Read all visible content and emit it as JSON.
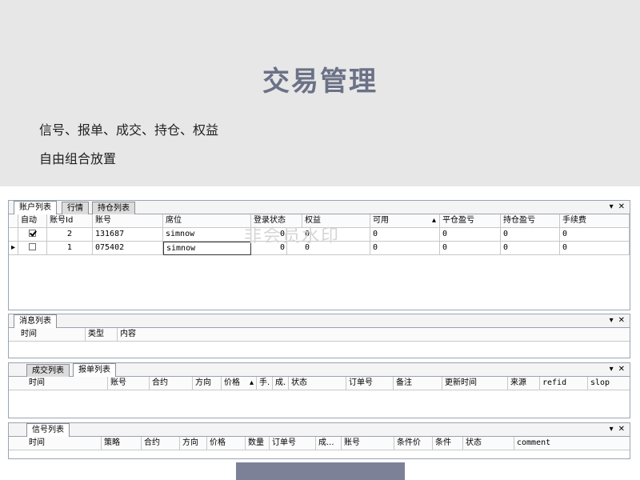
{
  "slide": {
    "title": "交易管理",
    "line1": "信号、报单、成交、持仓、权益",
    "line2": "自由组合放置"
  },
  "strip_controls": {
    "dropdown": "▾",
    "close": "✕"
  },
  "account_panel": {
    "tabs": [
      "账户列表",
      "行情",
      "持仓列表"
    ],
    "columns": [
      "自动",
      "账号Id",
      "账号",
      "席位",
      "登录状态",
      "权益",
      "可用",
      "平仓盈亏",
      "持仓盈亏",
      "手续费"
    ],
    "sort_indicator": "▴",
    "rows": [
      {
        "marker": "",
        "auto": true,
        "id": "2",
        "account": "131687",
        "seat": "simnow",
        "login": "0",
        "equity": "0",
        "available": "0",
        "close_pnl": "0",
        "pos_pnl": "0",
        "fee": "0"
      },
      {
        "marker": "▸",
        "auto": false,
        "id": "1",
        "account": "075402",
        "seat": "simnow",
        "login": "0",
        "equity": "0",
        "available": "0",
        "close_pnl": "0",
        "pos_pnl": "0",
        "fee": "0"
      }
    ]
  },
  "watermark": "非会员水印",
  "message_panel": {
    "tabs": [
      "消息列表"
    ],
    "columns": [
      "时间",
      "类型",
      "内容"
    ]
  },
  "order_panel": {
    "tabs": [
      "成交列表",
      "报单列表"
    ],
    "columns": [
      "时间",
      "账号",
      "合约",
      "方向",
      "价格",
      "手.",
      "成.",
      "状态",
      "订单号",
      "备注",
      "更新时间",
      "来源",
      "refid",
      "slop"
    ],
    "sort_indicator": "▴"
  },
  "signal_panel": {
    "tabs": [
      "信号列表"
    ],
    "columns": [
      "时间",
      "策略",
      "合约",
      "方向",
      "价格",
      "数量",
      "订单号",
      "成...",
      "账号",
      "条件价",
      "条件",
      "状态",
      "comment"
    ]
  },
  "colors": {
    "title": "#6b7186",
    "slide_bg": "#e7e7e7",
    "bar": "#7c8198"
  }
}
